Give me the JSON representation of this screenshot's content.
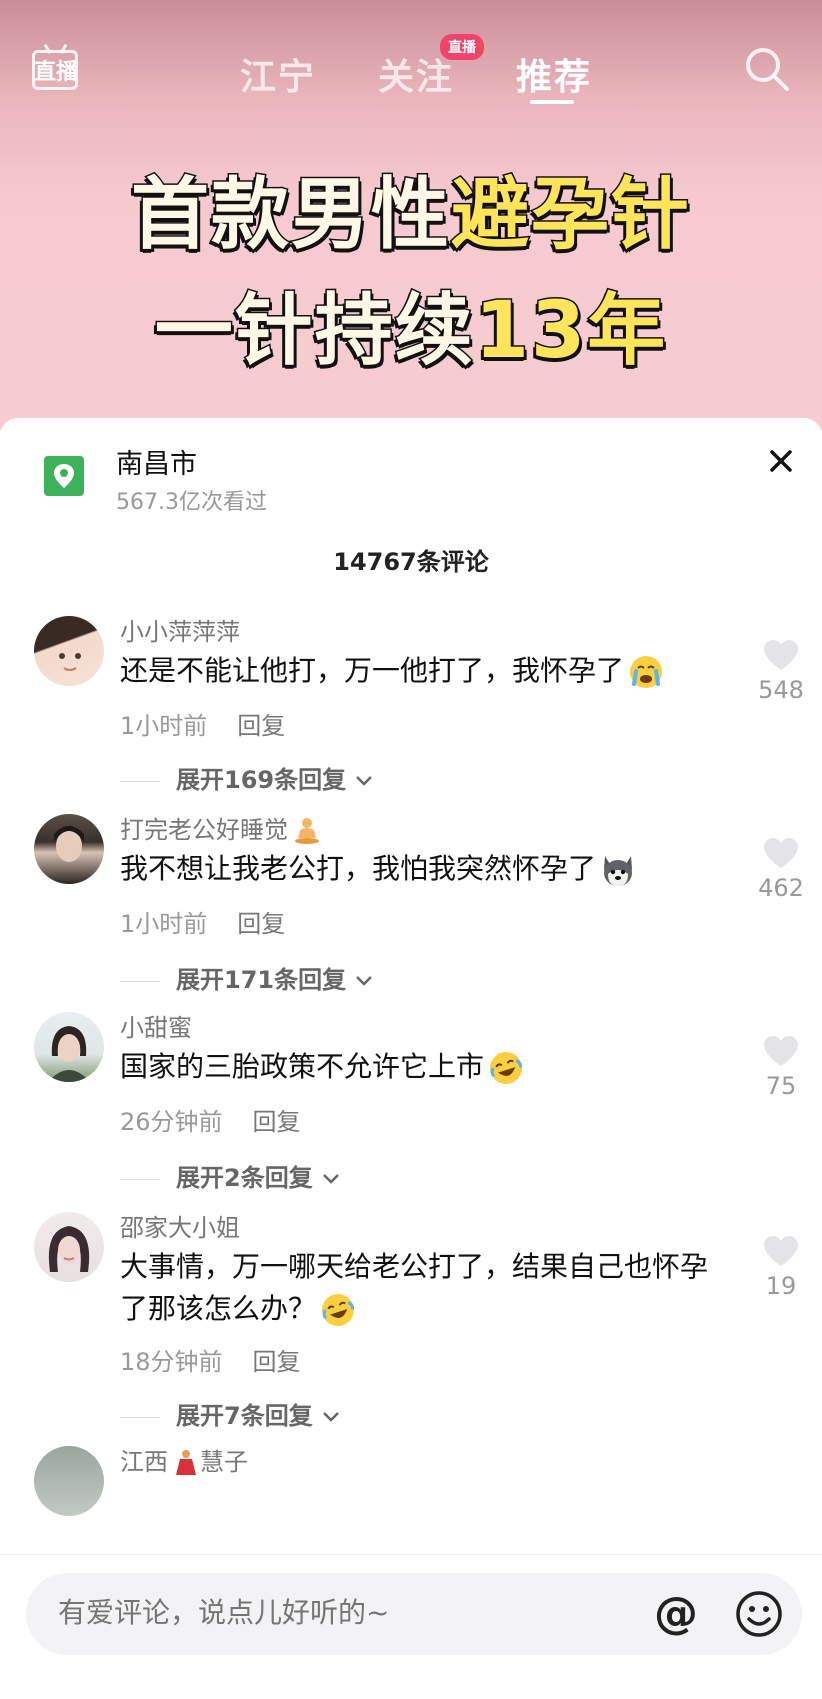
{
  "header": {
    "live_label": "直播",
    "tabs": [
      {
        "label": "江宁"
      },
      {
        "label": "关注",
        "badge": "直播"
      },
      {
        "label": "推荐",
        "active": true
      }
    ],
    "headline_line1_white": "首款男性",
    "headline_line1_yellow": "避孕针",
    "headline_line2_white": "一针持续",
    "headline_line2_yellow": "13年"
  },
  "location": {
    "title": "南昌市",
    "views": "567.3亿次看过"
  },
  "comment_count": "14767条评论",
  "comments": [
    {
      "user": "小小萍萍萍",
      "text": "还是不能让他打，万一他打了，我怀孕了",
      "time": "1小时前",
      "reply": "回复",
      "expand": "展开169条回复",
      "likes": "548"
    },
    {
      "user": "打完老公好睡觉",
      "text": "我不想让我老公打，我怕我突然怀孕了",
      "time": "1小时前",
      "reply": "回复",
      "expand": "展开171条回复",
      "likes": "462"
    },
    {
      "user": "小甜蜜",
      "text": "国家的三胎政策不允许它上市",
      "time": "26分钟前",
      "reply": "回复",
      "expand": "展开2条回复",
      "likes": "75"
    },
    {
      "user": "邵家大小姐",
      "text": "大事情，万一哪天给老公打了，结果自己也怀孕了那该怎么办？",
      "time": "18分钟前",
      "reply": "回复",
      "expand": "展开7条回复",
      "likes": "19"
    },
    {
      "user_a": "江西",
      "user_b": "慧子"
    }
  ],
  "input": {
    "placeholder": "有爱评论，说点儿好听的~",
    "at_label": "@"
  },
  "colors": {
    "accent_badge": "#f0436e",
    "headline_yellow": "#ffe45c",
    "location_icon": "#3eb15b"
  }
}
